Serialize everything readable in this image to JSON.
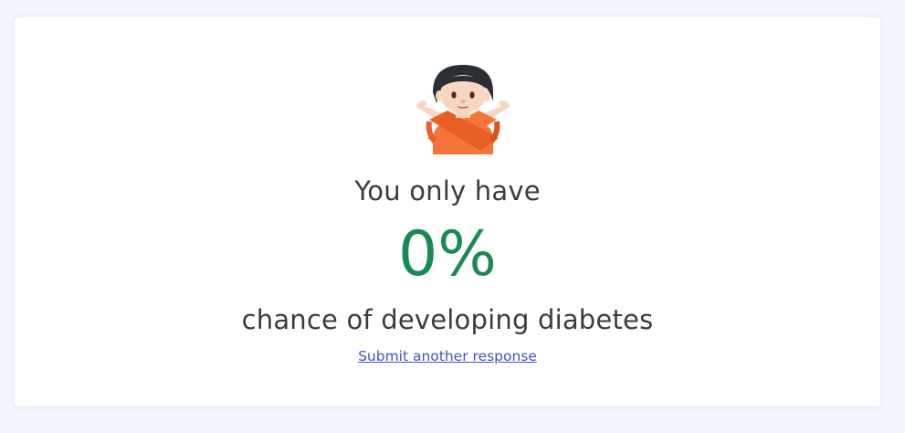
{
  "result": {
    "emoji_icon": "person-gesturing-no-icon",
    "lead_text": "You only have",
    "percent_text": "0%",
    "tail_text": "chance of developing diabetes",
    "link_text": "Submit another response",
    "percent_color": "#1a8a55",
    "link_color": "#4252c8"
  }
}
